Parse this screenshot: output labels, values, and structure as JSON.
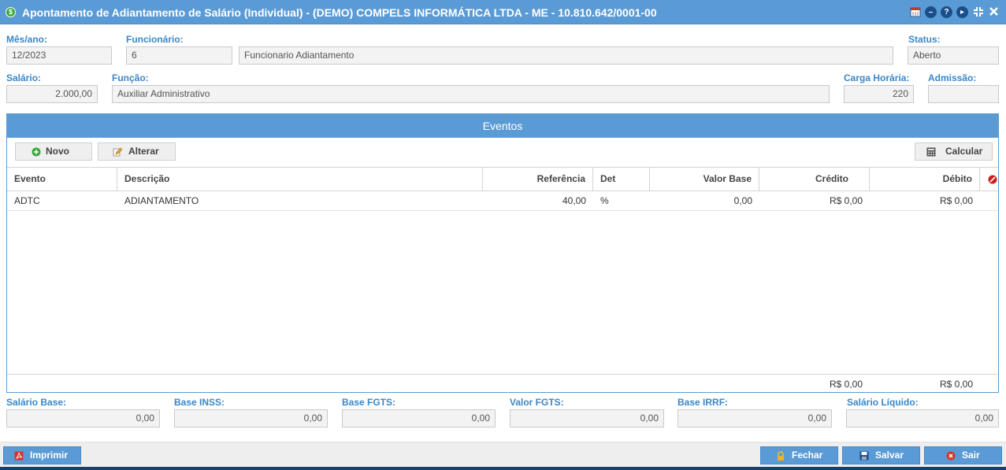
{
  "window": {
    "title": "Apontamento de Adiantamento de Salário (Individual) - (DEMO) COMPELS INFORMÁTICA LTDA - ME - 10.810.642/0001-00",
    "toolbar_icons": [
      "calendar-icon",
      "minimize-icon",
      "help-icon",
      "play-icon",
      "collapse-icon",
      "close-icon"
    ]
  },
  "form": {
    "mes_ano": {
      "label": "Mês/ano:",
      "value": "12/2023"
    },
    "funcionario": {
      "label": "Funcionário:",
      "code": "6",
      "name": "Funcionario Adiantamento"
    },
    "status": {
      "label": "Status:",
      "value": "Aberto"
    },
    "salario": {
      "label": "Salário:",
      "value": "2.000,00"
    },
    "funcao": {
      "label": "Função:",
      "value": "Auxiliar Administrativo"
    },
    "carga_horaria": {
      "label": "Carga Horária:",
      "value": "220"
    },
    "admissao": {
      "label": "Admissão:",
      "value": ""
    }
  },
  "events": {
    "title": "Eventos",
    "buttons": {
      "novo": "Novo",
      "alterar": "Alterar",
      "calcular": "Calcular"
    },
    "columns": [
      "Evento",
      "Descrição",
      "Referência",
      "Det",
      "Valor Base",
      "Crédito",
      "Débito"
    ],
    "rows": [
      {
        "evento": "ADTC",
        "descricao": "ADIANTAMENTO",
        "referencia": "40,00",
        "det": "%",
        "valor_base": "0,00",
        "credito": "R$ 0,00",
        "debito": "R$ 0,00"
      }
    ],
    "totals": {
      "credito": "R$ 0,00",
      "debito": "R$ 0,00"
    }
  },
  "summary": [
    {
      "label": "Salário Base:",
      "value": "0,00"
    },
    {
      "label": "Base INSS:",
      "value": "0,00"
    },
    {
      "label": "Base FGTS:",
      "value": "0,00"
    },
    {
      "label": "Valor FGTS:",
      "value": "0,00"
    },
    {
      "label": "Base IRRF:",
      "value": "0,00"
    },
    {
      "label": "Salário Líquido:",
      "value": "0,00"
    }
  ],
  "footer": {
    "imprimir": "Imprimir",
    "fechar": "Fechar",
    "salvar": "Salvar",
    "sair": "Sair"
  },
  "colors": {
    "accent": "#5b9bd5",
    "label": "#3a87c8"
  }
}
